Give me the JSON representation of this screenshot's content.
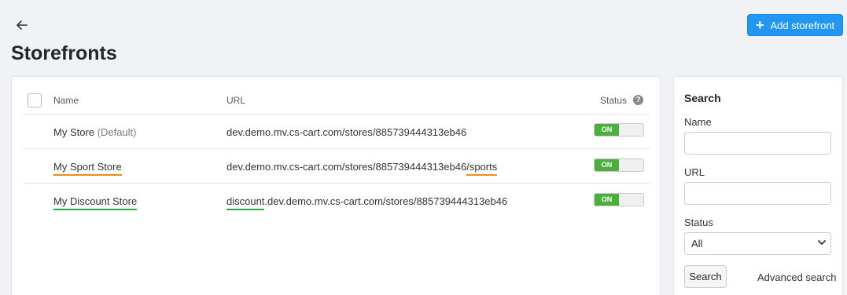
{
  "header": {
    "back_icon": "arrow-left-icon",
    "title": "Storefronts",
    "add_button": {
      "icon": "plus-icon",
      "label": "Add storefront",
      "color": "#2296f3"
    }
  },
  "table": {
    "columns": {
      "name": "Name",
      "url": "URL",
      "status": "Status"
    },
    "help_icon": "question-circle-icon",
    "rows": [
      {
        "name": "My Store",
        "suffix": "(Default)",
        "url": "dev.demo.mv.cs-cart.com/stores/885739444313eb46",
        "status": "ON"
      },
      {
        "name": "My Sport Store",
        "url_base": "dev.demo.mv.cs-cart.com/stores/885739444313eb46",
        "url_path": "/sports",
        "status": "ON"
      },
      {
        "name": "My Discount Store",
        "url_sub": "discount",
        "url_rest": ".dev.demo.mv.cs-cart.com/stores/885739444313eb46",
        "status": "ON"
      }
    ]
  },
  "search": {
    "title": "Search",
    "name_label": "Name",
    "name_value": "",
    "url_label": "URL",
    "url_value": "",
    "status_label": "Status",
    "status_value": "All",
    "search_button": "Search",
    "advanced_link": "Advanced search"
  },
  "colors": {
    "toggle_on": "#4cae3f",
    "highlight_orange": "#f08a1c",
    "highlight_green": "#21a84a"
  }
}
